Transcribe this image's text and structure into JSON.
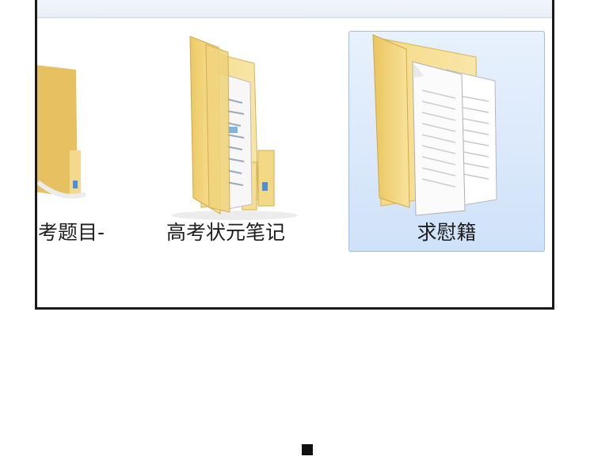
{
  "items": [
    {
      "label": "考题目-",
      "icon": "folder-icon"
    },
    {
      "label": "高考状元笔记",
      "icon": "folder-with-papers-icon"
    },
    {
      "label": "求慰籍",
      "icon": "folder-with-documents-icon",
      "selected": true
    }
  ],
  "colors": {
    "selection_background": "#cfe2f9",
    "selection_border": "#9bbfe6",
    "folder_yellow": "#f4d67a",
    "window_border": "#1a1a1a"
  }
}
